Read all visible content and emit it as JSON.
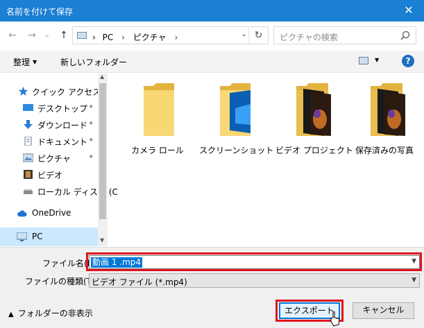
{
  "window": {
    "title": "名前を付けて保存",
    "close_glyph": "✕"
  },
  "nav": {
    "back_glyph": "←",
    "forward_glyph": "→",
    "history_glyph": "⌄",
    "up_glyph": "↑",
    "breadcrumbs": [
      "PC",
      "ピクチャ"
    ],
    "crumb_sep": "›",
    "dropdown_glyph": "⌄",
    "refresh_glyph": "↻",
    "search_placeholder": "ピクチャの検索"
  },
  "toolbar": {
    "organize": "整理",
    "new_folder": "新しいフォルダー",
    "help": "?"
  },
  "sidebar": {
    "items": [
      {
        "label": "クイック アクセス",
        "icon": "star-icon",
        "pinned": false
      },
      {
        "label": "デスクトップ",
        "icon": "desktop-icon",
        "pinned": true
      },
      {
        "label": "ダウンロード",
        "icon": "download-icon",
        "pinned": true
      },
      {
        "label": "ドキュメント",
        "icon": "document-icon",
        "pinned": true
      },
      {
        "label": "ピクチャ",
        "icon": "pictures-icon",
        "pinned": true
      },
      {
        "label": "ビデオ",
        "icon": "video-icon",
        "pinned": false
      },
      {
        "label": "ローカル ディスク (C",
        "icon": "disk-icon",
        "pinned": false
      },
      {
        "label": "OneDrive",
        "icon": "cloud-icon",
        "pinned": false
      },
      {
        "label": "PC",
        "icon": "pc-icon",
        "pinned": false
      }
    ],
    "pin_glyph": "📌"
  },
  "folders": [
    {
      "name": "カメラ ロール",
      "thumbnail": "plain"
    },
    {
      "name": "スクリーンショット",
      "thumbnail": "screenshot"
    },
    {
      "name": "ビデオ プロジェクト",
      "thumbnail": "photo"
    },
    {
      "name": "保存済みの写真",
      "thumbnail": "photo"
    }
  ],
  "form": {
    "filename_label": "ファイル名(N):",
    "filename_value": "動画 1 .mp4",
    "filetype_label": "ファイルの種類(T):",
    "filetype_value": "ビデオ ファイル (*.mp4)",
    "hide_folders": "フォルダーの非表示",
    "export_button": "エクスポート",
    "cancel_button": "キャンセル"
  },
  "colors": {
    "titlebar": "#1b7fd3",
    "highlight_outline": "#e0141e",
    "selection": "#0078d7",
    "folder": "#f7d774"
  }
}
